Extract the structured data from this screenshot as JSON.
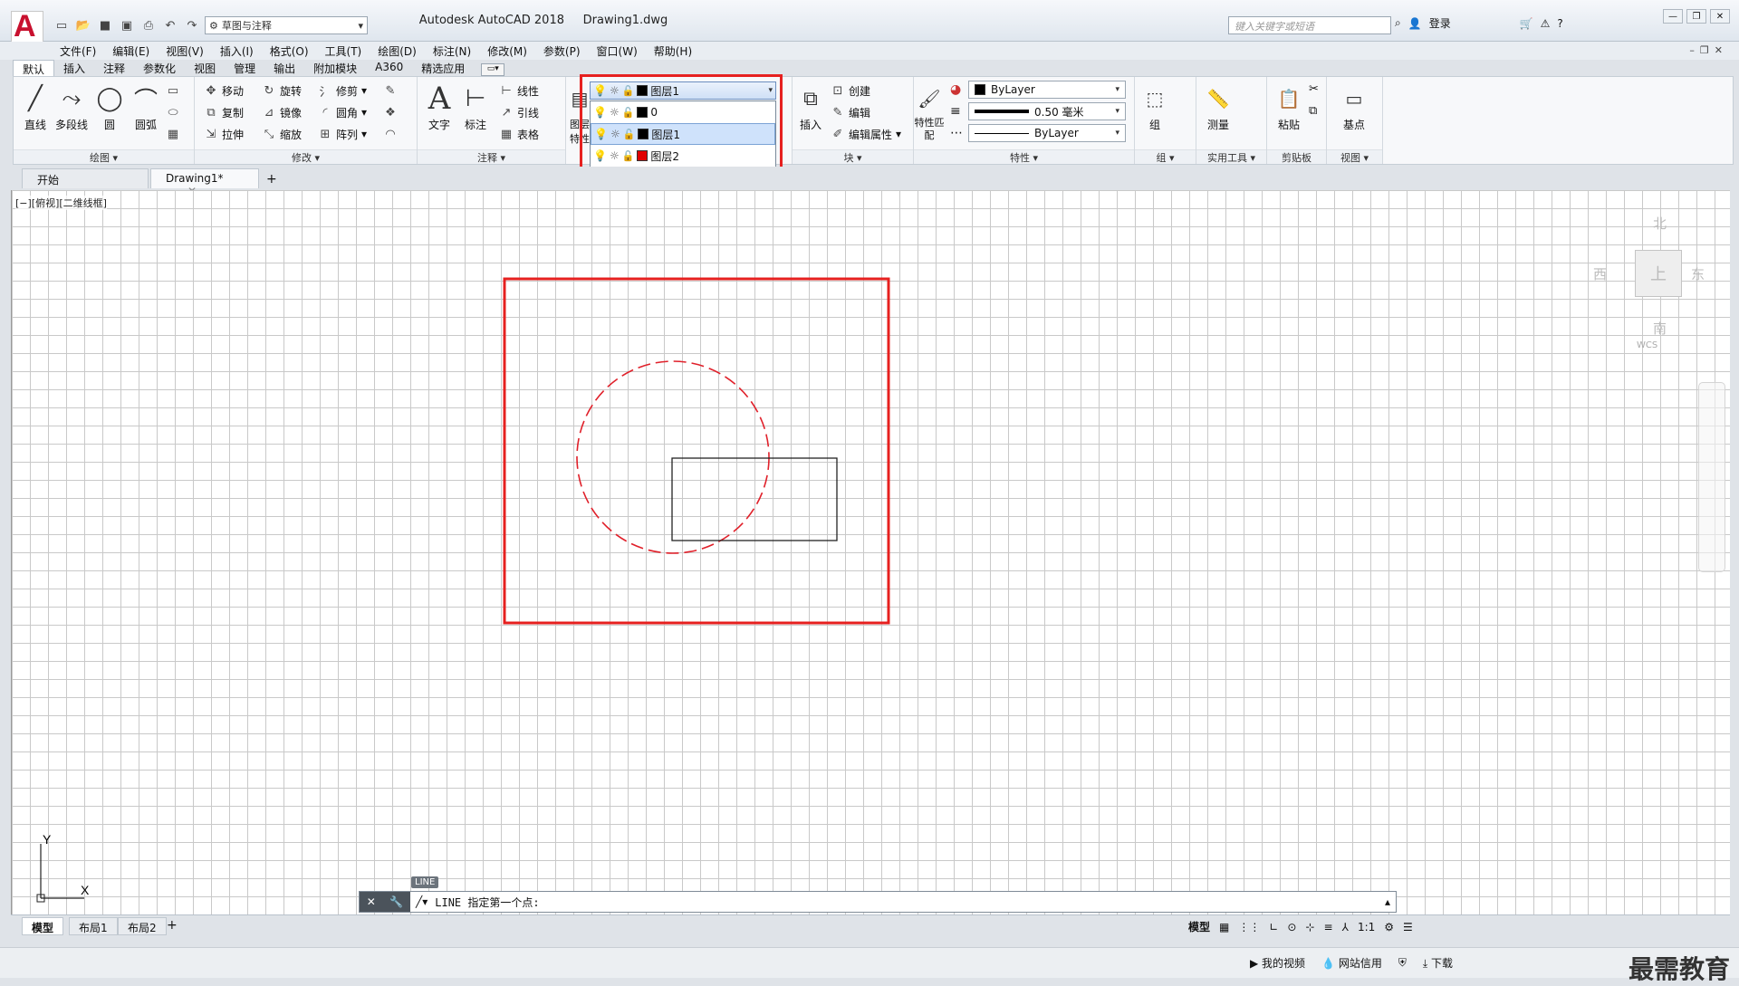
{
  "window": {
    "app_title": "Autodesk AutoCAD 2018",
    "file_name": "Drawing1.dwg",
    "workspace": "草图与注释",
    "search_placeholder": "键入关键字或短语",
    "login_label": "登录"
  },
  "menu": [
    "文件(F)",
    "编辑(E)",
    "视图(V)",
    "插入(I)",
    "格式(O)",
    "工具(T)",
    "绘图(D)",
    "标注(N)",
    "修改(M)",
    "参数(P)",
    "窗口(W)",
    "帮助(H)"
  ],
  "ribbon_tabs": [
    "默认",
    "插入",
    "注释",
    "参数化",
    "视图",
    "管理",
    "输出",
    "附加模块",
    "A360",
    "精选应用"
  ],
  "ribbon": {
    "draw": {
      "title": "绘图",
      "line": "直线",
      "polyline": "多段线",
      "circle": "圆",
      "arc": "圆弧"
    },
    "modify": {
      "title": "修改",
      "move": "移动",
      "rotate": "旋转",
      "trim": "修剪",
      "copy": "复制",
      "mirror": "镜像",
      "fillet": "圆角",
      "stretch": "拉伸",
      "scale": "缩放",
      "array": "阵列"
    },
    "annotation": {
      "title": "注释",
      "text": "文字",
      "dimension": "标注",
      "linear": "线性",
      "leader": "引线",
      "table": "表格"
    },
    "layers": {
      "props": "图层特性"
    },
    "block": {
      "title": "块",
      "insert": "插入",
      "create": "创建",
      "edit": "编辑",
      "edit_attr": "编辑属性"
    },
    "properties": {
      "title": "特性",
      "match": "特性匹配",
      "color": "ByLayer",
      "lineweight": "0.50 毫米",
      "linetype": "ByLayer"
    },
    "groups": {
      "title": "组",
      "group": "组"
    },
    "utilities": {
      "title": "实用工具",
      "measure": "测量"
    },
    "clipboard": {
      "title": "剪贴板",
      "paste": "粘贴"
    },
    "view": {
      "title": "视图",
      "base": "基点"
    }
  },
  "layer_dropdown": {
    "current": {
      "name": "图层1",
      "color": "#000000"
    },
    "items": [
      {
        "name": "0",
        "color": "#000000",
        "selected": false
      },
      {
        "name": "图层1",
        "color": "#000000",
        "selected": true
      },
      {
        "name": "图层2",
        "color": "#e00000",
        "selected": false
      }
    ]
  },
  "file_tabs": {
    "start": "开始",
    "drawing": "Drawing1*"
  },
  "viewport_label": "[−][俯视][二维线框]",
  "viewcube": {
    "north": "北",
    "south": "南",
    "east": "东",
    "west": "西",
    "top": "上",
    "wcs": "WCS"
  },
  "ucs": {
    "x": "X",
    "y": "Y"
  },
  "command": {
    "tag": "LINE",
    "prompt": "LINE 指定第一个点:"
  },
  "layout_tabs": [
    "模型",
    "布局1",
    "布局2"
  ],
  "status": {
    "model": "模型",
    "scale": "1:1"
  },
  "taskbar": {
    "video": "我的视频",
    "credit": "网站信用",
    "download": "下载",
    "watermark": "最需教育"
  }
}
